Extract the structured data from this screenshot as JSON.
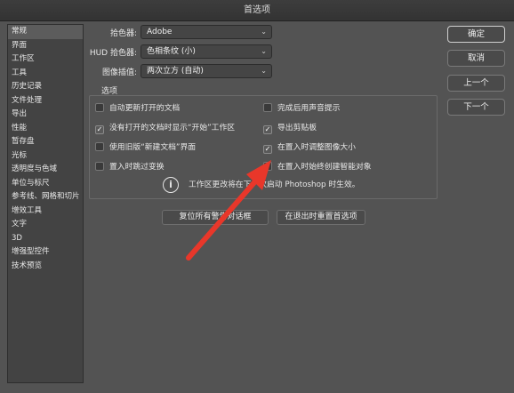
{
  "window": {
    "title": "首选项"
  },
  "sidebar": {
    "items": [
      {
        "label": "常规"
      },
      {
        "label": "界面"
      },
      {
        "label": "工作区"
      },
      {
        "label": "工具"
      },
      {
        "label": "历史记录"
      },
      {
        "label": "文件处理"
      },
      {
        "label": "导出"
      },
      {
        "label": "性能"
      },
      {
        "label": "暂存盘"
      },
      {
        "label": "光标"
      },
      {
        "label": "透明度与色域"
      },
      {
        "label": "单位与标尺"
      },
      {
        "label": "参考线、网格和切片"
      },
      {
        "label": "增效工具"
      },
      {
        "label": "文字"
      },
      {
        "label": "3D"
      },
      {
        "label": "增强型控件"
      },
      {
        "label": "技术预览"
      }
    ]
  },
  "settings": {
    "color_picker": {
      "label": "拾色器:",
      "value": "Adobe"
    },
    "hud_picker": {
      "label": "HUD 拾色器:",
      "value": "色相条纹 (小)"
    },
    "interpolation": {
      "label": "图像插值:",
      "value": "两次立方 (自动)"
    }
  },
  "options": {
    "title": "选项",
    "checkboxes": [
      {
        "label": "自动更新打开的文档",
        "checked": false
      },
      {
        "label": "完成后用声音提示",
        "checked": false
      },
      {
        "label": "没有打开的文档时显示“开始”工作区",
        "checked": true
      },
      {
        "label": "导出剪贴板",
        "checked": true
      },
      {
        "label": "使用旧版“新建文档”界面",
        "checked": false
      },
      {
        "label": "在置入时调整图像大小",
        "checked": true
      },
      {
        "label": "置入时跳过变换",
        "checked": false
      },
      {
        "label": "在置入时始终创建智能对象",
        "checked": false
      }
    ],
    "check_glyph": "✓",
    "info_glyph": "i",
    "info_text": "工作区更改将在下一次启动 Photoshop 时生效。"
  },
  "buttons": {
    "reset_warnings": "复位所有警告对话框",
    "reset_on_quit": "在退出时重置首选项"
  },
  "dialog_buttons": {
    "ok": "确定",
    "cancel": "取消",
    "prev": "上一个",
    "next": "下一个"
  },
  "select_chevron": "⌄",
  "annotation_color": "#e8372a"
}
